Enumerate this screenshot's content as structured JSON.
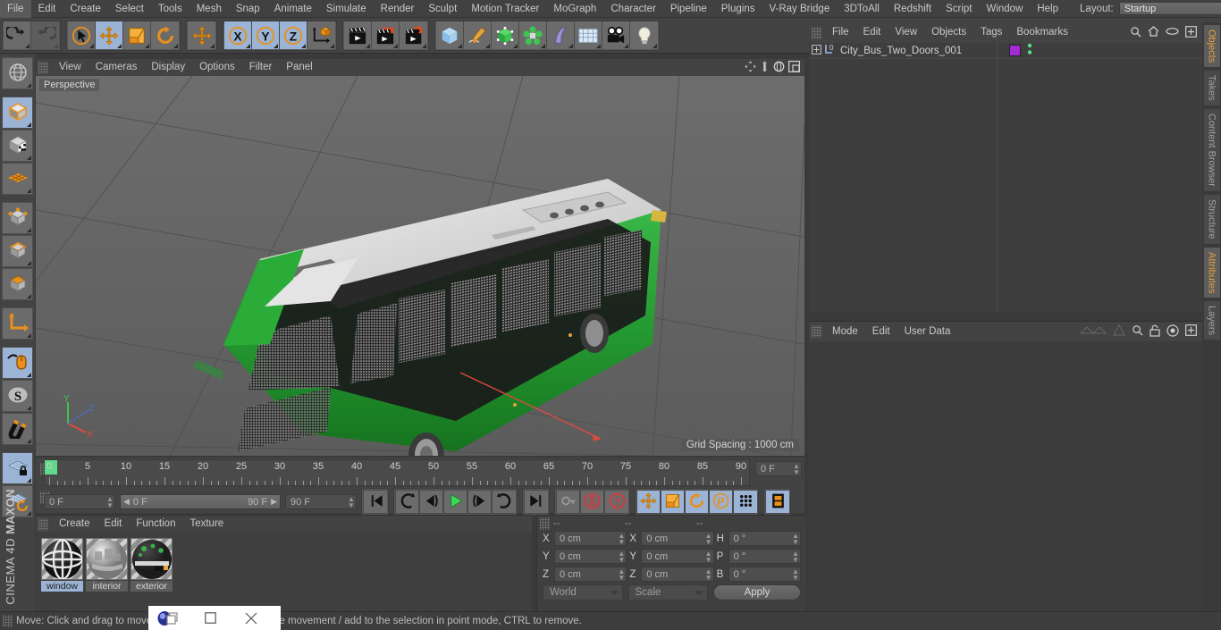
{
  "app": {
    "title": "CINEMA 4D",
    "vendor": "MAXON"
  },
  "menubar": {
    "items": [
      "File",
      "Edit",
      "Create",
      "Select",
      "Tools",
      "Mesh",
      "Snap",
      "Animate",
      "Simulate",
      "Render",
      "Sculpt",
      "Motion Tracker",
      "MoGraph",
      "Character",
      "Pipeline",
      "Plugins",
      "V-Ray Bridge",
      "3DToAll",
      "Redshift",
      "Script",
      "Window",
      "Help"
    ],
    "layout_label": "Layout:",
    "layout_value": "Startup",
    "search_icon": "search-icon"
  },
  "toolbar": {
    "groups": [
      {
        "name": "history",
        "buttons": [
          {
            "name": "undo",
            "icon": "undo-arrow-icon",
            "selected": false,
            "dim": false
          },
          {
            "name": "redo",
            "icon": "redo-arrow-icon",
            "selected": false,
            "dim": true
          }
        ]
      },
      {
        "name": "transform",
        "buttons": [
          {
            "name": "live-selection",
            "icon": "cursor-circle-icon",
            "selected": false,
            "dim": false
          },
          {
            "name": "move",
            "icon": "move-arrows-icon",
            "selected": true,
            "dim": false
          },
          {
            "name": "scale",
            "icon": "scale-box-icon",
            "selected": false,
            "dim": false
          },
          {
            "name": "rotate",
            "icon": "rotate-circle-icon",
            "selected": false,
            "dim": false
          }
        ]
      },
      {
        "name": "dynamic-place",
        "buttons": [
          {
            "name": "dynamic-place",
            "icon": "move-arrows-icon",
            "selected": false,
            "dim": false
          }
        ]
      },
      {
        "name": "axis-lock",
        "buttons": [
          {
            "name": "lock-x",
            "icon": "x-axis-icon",
            "selected": true,
            "dim": false
          },
          {
            "name": "lock-y",
            "icon": "y-axis-icon",
            "selected": true,
            "dim": false
          },
          {
            "name": "lock-z",
            "icon": "z-axis-icon",
            "selected": true,
            "dim": false
          },
          {
            "name": "world-object-coord",
            "icon": "world-axis-cube-icon",
            "selected": false,
            "dim": false
          }
        ]
      },
      {
        "name": "render",
        "buttons": [
          {
            "name": "render-view",
            "icon": "clapperboard-icon",
            "selected": false,
            "dim": false
          },
          {
            "name": "render-to-picture-viewer",
            "icon": "clapperboard-picture-icon",
            "selected": false,
            "dim": false
          },
          {
            "name": "render-settings",
            "icon": "clapperboard-gear-icon",
            "selected": false,
            "dim": false
          }
        ]
      },
      {
        "name": "create",
        "buttons": [
          {
            "name": "cube-primitive",
            "icon": "blue-cube-icon",
            "selected": false,
            "dim": false
          },
          {
            "name": "spline-pen",
            "icon": "pen-spline-icon",
            "selected": false,
            "dim": false
          },
          {
            "name": "generator-subdivision",
            "icon": "green-cube-points-icon",
            "selected": false,
            "dim": false
          },
          {
            "name": "mograph-cloner",
            "icon": "green-cluster-icon",
            "selected": false,
            "dim": false
          },
          {
            "name": "deformer",
            "icon": "purple-bend-icon",
            "selected": false,
            "dim": false
          },
          {
            "name": "scene-floor",
            "icon": "grid-floor-icon",
            "selected": false,
            "dim": false
          },
          {
            "name": "camera",
            "icon": "camera-icon",
            "selected": false,
            "dim": false
          },
          {
            "name": "light",
            "icon": "light-bulb-icon",
            "selected": false,
            "dim": false
          }
        ]
      }
    ]
  },
  "left_toolbar": {
    "buttons": [
      {
        "name": "make-editable",
        "icon": "globe-wire-icon",
        "selected": false
      },
      {
        "name": "model-mode",
        "icon": "orange-cube-icon",
        "selected": true
      },
      {
        "name": "texture-mode",
        "icon": "checker-cube-icon",
        "selected": false
      },
      {
        "name": "workplane-mode",
        "icon": "orange-grid-icon",
        "selected": false
      },
      {
        "name": "points-mode",
        "icon": "cube-points-icon",
        "selected": false
      },
      {
        "name": "edges-mode",
        "icon": "cube-edges-icon",
        "selected": false
      },
      {
        "name": "polygons-mode",
        "icon": "cube-polygon-icon",
        "selected": false
      },
      {
        "name": "axis-modification",
        "icon": "axis-corner-icon",
        "selected": false
      },
      {
        "name": "enable-snapping",
        "icon": "mouse-snap-icon",
        "selected": true
      },
      {
        "name": "soft-selection",
        "icon": "s-circle-icon",
        "selected": false
      },
      {
        "name": "magnet-tool",
        "icon": "magnet-icon",
        "selected": false
      },
      {
        "name": "workplane-lock",
        "icon": "grid-lock-icon",
        "selected": true
      },
      {
        "name": "workplane-rotate",
        "icon": "grid-rotate-icon",
        "selected": false
      }
    ]
  },
  "viewport": {
    "menu": [
      "View",
      "Cameras",
      "Display",
      "Options",
      "Filter",
      "Panel"
    ],
    "label": "Perspective",
    "grid_spacing": "Grid Spacing : 1000 cm",
    "axis_labels": {
      "x": "X",
      "y": "Y",
      "z": "Z"
    },
    "corner_icons": [
      "pan-icon",
      "dolly-icon",
      "orbit-icon",
      "maximize-view-icon"
    ],
    "scene_object": "green city bus three-quarter view on grey grid floor"
  },
  "timeline": {
    "ruler_labels": [
      "0",
      "5",
      "10",
      "15",
      "20",
      "25",
      "30",
      "35",
      "40",
      "45",
      "50",
      "55",
      "60",
      "65",
      "70",
      "75",
      "80",
      "85",
      "90"
    ],
    "current_frame_field": "0 F",
    "start_field": "0 F",
    "range_start": "0 F",
    "range_end": "90 F",
    "end_field": "90 F",
    "buttons": [
      {
        "name": "go-to-start",
        "icon": "skip-start-icon",
        "selected": false
      },
      {
        "name": "play-reverse-loop",
        "icon": "loop-back-icon",
        "selected": false
      },
      {
        "name": "previous-frame",
        "icon": "step-back-icon",
        "selected": false
      },
      {
        "name": "play",
        "icon": "play-icon",
        "selected": false
      },
      {
        "name": "next-frame",
        "icon": "step-forward-icon",
        "selected": false
      },
      {
        "name": "loop-forward",
        "icon": "loop-forward-icon",
        "selected": false
      },
      {
        "name": "go-to-end",
        "icon": "skip-end-icon",
        "selected": false
      },
      {
        "name": "record-active-objects",
        "icon": "key-icon",
        "selected": false
      },
      {
        "name": "autokeying",
        "icon": "red-record-icon",
        "selected": false
      },
      {
        "name": "keyframe-selection",
        "icon": "red-question-icon",
        "selected": false
      },
      {
        "name": "position-key",
        "icon": "move-arrows-icon",
        "selected": true
      },
      {
        "name": "scale-key",
        "icon": "scale-box-icon",
        "selected": true
      },
      {
        "name": "rotation-key",
        "icon": "rotate-circle-icon",
        "selected": true
      },
      {
        "name": "parameter-key",
        "icon": "p-circle-icon",
        "selected": true
      },
      {
        "name": "point-level-animation",
        "icon": "dots-grid-icon",
        "selected": true
      },
      {
        "name": "timeline-toggle",
        "icon": "film-strip-icon",
        "selected": true
      }
    ]
  },
  "materials": {
    "menu": [
      "Create",
      "Edit",
      "Function",
      "Texture"
    ],
    "items": [
      {
        "name": "window",
        "label": "window",
        "selected": true
      },
      {
        "name": "interior",
        "label": "interior",
        "selected": false
      },
      {
        "name": "exterior",
        "label": "exterior",
        "selected": false
      }
    ]
  },
  "coordinates": {
    "headers": [
      "--",
      "--",
      "--"
    ],
    "rows": [
      {
        "label_pos": "X",
        "value_pos": "0 cm",
        "label_size": "X",
        "value_size": "0 cm",
        "label_rot": "H",
        "value_rot": "0 °"
      },
      {
        "label_pos": "Y",
        "value_pos": "0 cm",
        "label_size": "Y",
        "value_size": "0 cm",
        "label_rot": "P",
        "value_rot": "0 °"
      },
      {
        "label_pos": "Z",
        "value_pos": "0 cm",
        "label_size": "Z",
        "value_size": "0 cm",
        "label_rot": "B",
        "value_rot": "0 °"
      }
    ],
    "system": "World",
    "mode": "Scale",
    "apply": "Apply"
  },
  "objects_panel": {
    "menu": [
      "File",
      "Edit",
      "View",
      "Objects",
      "Tags",
      "Bookmarks"
    ],
    "icons": [
      "search-icon",
      "home-icon",
      "eye-icon",
      "plus-box-icon"
    ],
    "item": {
      "name": "City_Bus_Two_Doors_001",
      "layer_badge": "0",
      "tag_color": "#a32bd4",
      "dots_color": "#5fd98a"
    }
  },
  "attributes_panel": {
    "menu": [
      "Mode",
      "Edit",
      "User Data"
    ],
    "icons": [
      "wave-icon",
      "triangle-icon",
      "search-icon",
      "lock-icon",
      "target-icon",
      "plus-box-icon"
    ]
  },
  "side_tabs": [
    {
      "label": "Objects",
      "active": true
    },
    {
      "label": "Takes",
      "active": false
    },
    {
      "label": "Content Browser",
      "active": false
    },
    {
      "label": "Structure",
      "active": false
    },
    {
      "label": "Attributes",
      "active": true
    },
    {
      "label": "Layers",
      "active": false
    }
  ],
  "status_bar": {
    "text": "Move: Click and drag to move elements. SHIFT to quantize movement / add to the selection in point mode, CTRL to remove."
  },
  "overlay_window": {
    "app_icon": "blue-orb-icon",
    "restore_icon": "restore-window-icon",
    "maximize_icon": "maximize-window-icon",
    "close_icon": "close-window-icon"
  },
  "colors": {
    "accent_orange": "#e8a33d",
    "selected_blue": "#9bb4d6",
    "panel_bg": "#434343",
    "viewport_bg": "#6a6a6a",
    "bus_green": "#27a03a"
  }
}
